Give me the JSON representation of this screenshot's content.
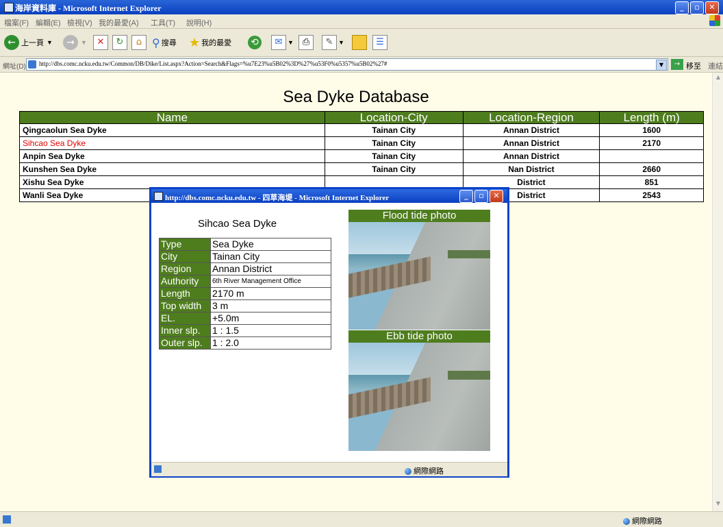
{
  "window": {
    "title": "海岸資料庫 - Microsoft Internet Explorer",
    "minimize": "_",
    "maximize": "▫",
    "close": "✕"
  },
  "menu": [
    "檔案(F)",
    "編輯(E)",
    "檢視(V)",
    "我的最愛(A)",
    "工具(T)",
    "說明(H)"
  ],
  "toolbar": {
    "back": "上一頁",
    "search": "搜尋",
    "favorites": "我的最愛"
  },
  "address": {
    "label": "網址(D)",
    "url": "http://dbs.comc.ncku.edu.tw/Common/DB/Dike/List.aspx?Action=Search&Flags=%u7E23%u5B02%3D%27%u53F0%u5357%u5B02%27#",
    "go": "移至",
    "links": "連結"
  },
  "page": {
    "title": "Sea Dyke Database",
    "headers": [
      "Name",
      "Location-City",
      "Location-Region",
      "Length (m)"
    ],
    "rows": [
      {
        "name": "Qingcaolun Sea Dyke",
        "city": "Tainan City",
        "region": "Annan District",
        "length": "1600"
      },
      {
        "name": "Sihcao Sea Dyke",
        "city": "Tainan City",
        "region": "Annan District",
        "length": "2170"
      },
      {
        "name": "Anpin Sea Dyke",
        "city": "Tainan City",
        "region": "Annan District",
        "length": ""
      },
      {
        "name": "Kunshen Sea Dyke",
        "city": "Tainan City",
        "region": "Nan District",
        "length": "2660"
      },
      {
        "name": "Xishu Sea Dyke",
        "city": "",
        "region": "District",
        "length": "851"
      },
      {
        "name": "Wanli Sea Dyke",
        "city": "",
        "region": "District",
        "length": "2543"
      }
    ]
  },
  "status": {
    "zone": "網際網路"
  },
  "popup": {
    "title": "http://dbs.comc.ncku.edu.tw - 四草海堤 - Microsoft Internet Explorer",
    "name": "Sihcao Sea Dyke",
    "info": [
      {
        "key": "Type",
        "value": "Sea Dyke"
      },
      {
        "key": "City",
        "value": "Tainan City"
      },
      {
        "key": "Region",
        "value": "Annan District"
      },
      {
        "key": "Authority",
        "value": "6th River Management Office"
      },
      {
        "key": "Length",
        "value": "2170 m"
      },
      {
        "key": "Top width",
        "value": "3 m"
      },
      {
        "key": "EL.",
        "value": "+5.0m"
      },
      {
        "key": "Inner slp.",
        "value": "1 : 1.5"
      },
      {
        "key": "Outer slp.",
        "value": "1 : 2.0"
      }
    ],
    "flood_label": "Flood tide photo",
    "ebb_label": "Ebb tide photo",
    "status_zone": "網際網路"
  },
  "colors": {
    "header_green": "#4e7d1e",
    "selected_red": "#e00000",
    "xp_blue": "#0a3fc0"
  }
}
